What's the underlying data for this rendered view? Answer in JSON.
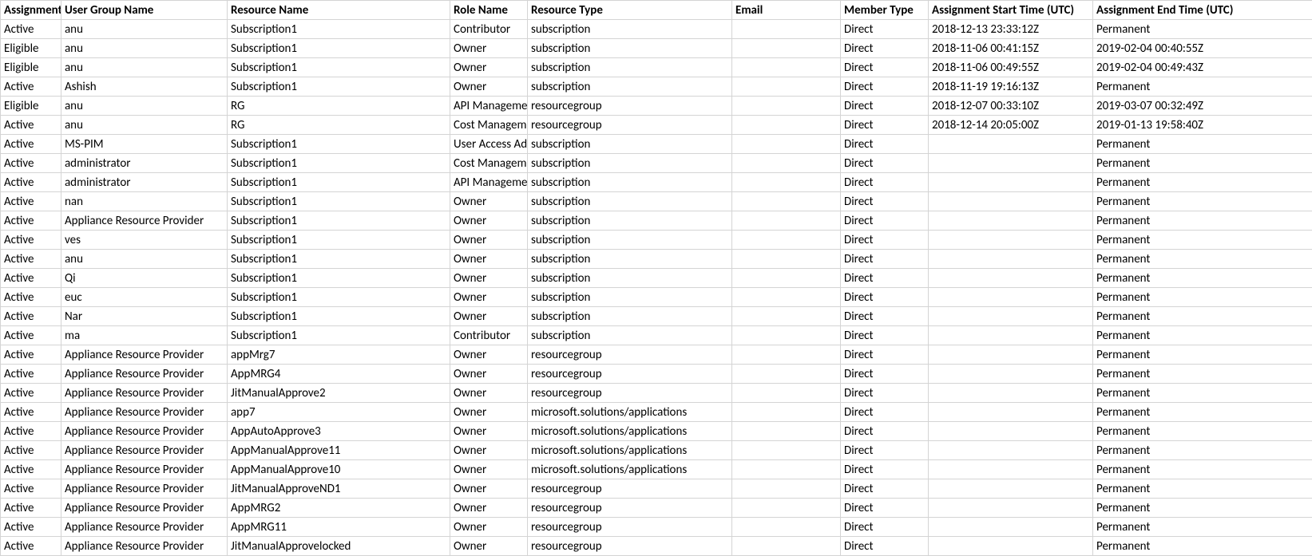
{
  "table": {
    "headers": {
      "assignment": "Assignment",
      "user_group_name": "User Group Name",
      "resource_name": "Resource Name",
      "role_name": "Role Name",
      "resource_type": "Resource Type",
      "email": "Email",
      "member_type": "Member Type",
      "assignment_start": "Assignment Start Time (UTC)",
      "assignment_end": "Assignment End Time (UTC)"
    },
    "rows": [
      {
        "assignment": "Active",
        "user_group_name": "anu",
        "resource_name": "Subscription1",
        "role_name": "Contributor",
        "resource_type": "subscription",
        "email": "",
        "member_type": "Direct",
        "start": "2018-12-13 23:33:12Z",
        "end": "Permanent"
      },
      {
        "assignment": "Eligible",
        "user_group_name": "anu",
        "resource_name": "Subscription1",
        "role_name": "Owner",
        "resource_type": "subscription",
        "email": "",
        "member_type": "Direct",
        "start": "2018-11-06 00:41:15Z",
        "end": "2019-02-04 00:40:55Z"
      },
      {
        "assignment": "Eligible",
        "user_group_name": "anu",
        "resource_name": "Subscription1",
        "role_name": "Owner",
        "resource_type": "subscription",
        "email": "",
        "member_type": "Direct",
        "start": "2018-11-06 00:49:55Z",
        "end": "2019-02-04 00:49:43Z"
      },
      {
        "assignment": "Active",
        "user_group_name": "Ashish",
        "resource_name": "Subscription1",
        "role_name": "Owner",
        "resource_type": "subscription",
        "email": "",
        "member_type": "Direct",
        "start": "2018-11-19 19:16:13Z",
        "end": "Permanent"
      },
      {
        "assignment": "Eligible",
        "user_group_name": "anu",
        "resource_name": "RG",
        "role_name": "API Management",
        "resource_type": "resourcegroup",
        "email": "",
        "member_type": "Direct",
        "start": "2018-12-07 00:33:10Z",
        "end": "2019-03-07 00:32:49Z"
      },
      {
        "assignment": "Active",
        "user_group_name": "anu",
        "resource_name": "RG",
        "role_name": "Cost Management",
        "resource_type": "resourcegroup",
        "email": "",
        "member_type": "Direct",
        "start": "2018-12-14 20:05:00Z",
        "end": "2019-01-13 19:58:40Z"
      },
      {
        "assignment": "Active",
        "user_group_name": "MS-PIM",
        "resource_name": "Subscription1",
        "role_name": "User Access Administrator",
        "resource_type": "subscription",
        "email": "",
        "member_type": "Direct",
        "start": "",
        "end": "Permanent"
      },
      {
        "assignment": "Active",
        "user_group_name": "administrator",
        "resource_name": "Subscription1",
        "role_name": "Cost Management",
        "resource_type": "subscription",
        "email": "",
        "member_type": "Direct",
        "start": "",
        "end": "Permanent"
      },
      {
        "assignment": "Active",
        "user_group_name": "administrator",
        "resource_name": "Subscription1",
        "role_name": "API Management",
        "resource_type": "subscription",
        "email": "",
        "member_type": "Direct",
        "start": "",
        "end": "Permanent"
      },
      {
        "assignment": "Active",
        "user_group_name": "nan",
        "resource_name": "Subscription1",
        "role_name": "Owner",
        "resource_type": "subscription",
        "email": "",
        "member_type": "Direct",
        "start": "",
        "end": "Permanent"
      },
      {
        "assignment": "Active",
        "user_group_name": "Appliance Resource Provider",
        "resource_name": "Subscription1",
        "role_name": "Owner",
        "resource_type": "subscription",
        "email": "",
        "member_type": "Direct",
        "start": "",
        "end": "Permanent"
      },
      {
        "assignment": "Active",
        "user_group_name": "ves",
        "resource_name": "Subscription1",
        "role_name": "Owner",
        "resource_type": "subscription",
        "email": "",
        "member_type": "Direct",
        "start": "",
        "end": "Permanent"
      },
      {
        "assignment": "Active",
        "user_group_name": "anu",
        "resource_name": "Subscription1",
        "role_name": "Owner",
        "resource_type": "subscription",
        "email": "",
        "member_type": "Direct",
        "start": "",
        "end": "Permanent"
      },
      {
        "assignment": "Active",
        "user_group_name": "Qi",
        "resource_name": "Subscription1",
        "role_name": "Owner",
        "resource_type": "subscription",
        "email": "",
        "member_type": "Direct",
        "start": "",
        "end": "Permanent"
      },
      {
        "assignment": "Active",
        "user_group_name": "euc",
        "resource_name": "Subscription1",
        "role_name": "Owner",
        "resource_type": "subscription",
        "email": "",
        "member_type": "Direct",
        "start": "",
        "end": "Permanent"
      },
      {
        "assignment": "Active",
        "user_group_name": "Nar",
        "resource_name": "Subscription1",
        "role_name": "Owner",
        "resource_type": "subscription",
        "email": "",
        "member_type": "Direct",
        "start": "",
        "end": "Permanent"
      },
      {
        "assignment": "Active",
        "user_group_name": "ma",
        "resource_name": "Subscription1",
        "role_name": "Contributor",
        "resource_type": "subscription",
        "email": "",
        "member_type": "Direct",
        "start": "",
        "end": "Permanent"
      },
      {
        "assignment": "Active",
        "user_group_name": "Appliance Resource Provider",
        "resource_name": "appMrg7",
        "role_name": "Owner",
        "resource_type": "resourcegroup",
        "email": "",
        "member_type": "Direct",
        "start": "",
        "end": "Permanent"
      },
      {
        "assignment": "Active",
        "user_group_name": "Appliance Resource Provider",
        "resource_name": "AppMRG4",
        "role_name": "Owner",
        "resource_type": "resourcegroup",
        "email": "",
        "member_type": "Direct",
        "start": "",
        "end": "Permanent"
      },
      {
        "assignment": "Active",
        "user_group_name": "Appliance Resource Provider",
        "resource_name": "JitManualApprove2",
        "role_name": "Owner",
        "resource_type": "resourcegroup",
        "email": "",
        "member_type": "Direct",
        "start": "",
        "end": "Permanent"
      },
      {
        "assignment": "Active",
        "user_group_name": "Appliance Resource Provider",
        "resource_name": "app7",
        "role_name": "Owner",
        "resource_type": "microsoft.solutions/applications",
        "email": "",
        "member_type": "Direct",
        "start": "",
        "end": "Permanent"
      },
      {
        "assignment": "Active",
        "user_group_name": "Appliance Resource Provider",
        "resource_name": "AppAutoApprove3",
        "role_name": "Owner",
        "resource_type": "microsoft.solutions/applications",
        "email": "",
        "member_type": "Direct",
        "start": "",
        "end": "Permanent"
      },
      {
        "assignment": "Active",
        "user_group_name": "Appliance Resource Provider",
        "resource_name": "AppManualApprove11",
        "role_name": "Owner",
        "resource_type": "microsoft.solutions/applications",
        "email": "",
        "member_type": "Direct",
        "start": "",
        "end": "Permanent"
      },
      {
        "assignment": "Active",
        "user_group_name": "Appliance Resource Provider",
        "resource_name": "AppManualApprove10",
        "role_name": "Owner",
        "resource_type": "microsoft.solutions/applications",
        "email": "",
        "member_type": "Direct",
        "start": "",
        "end": "Permanent"
      },
      {
        "assignment": "Active",
        "user_group_name": "Appliance Resource Provider",
        "resource_name": "JitManualApproveND1",
        "role_name": "Owner",
        "resource_type": "resourcegroup",
        "email": "",
        "member_type": "Direct",
        "start": "",
        "end": "Permanent"
      },
      {
        "assignment": "Active",
        "user_group_name": "Appliance Resource Provider",
        "resource_name": "AppMRG2",
        "role_name": "Owner",
        "resource_type": "resourcegroup",
        "email": "",
        "member_type": "Direct",
        "start": "",
        "end": "Permanent"
      },
      {
        "assignment": "Active",
        "user_group_name": "Appliance Resource Provider",
        "resource_name": "AppMRG11",
        "role_name": "Owner",
        "resource_type": "resourcegroup",
        "email": "",
        "member_type": "Direct",
        "start": "",
        "end": "Permanent"
      },
      {
        "assignment": "Active",
        "user_group_name": "Appliance Resource Provider",
        "resource_name": "JitManualApprovelocked",
        "role_name": "Owner",
        "resource_type": "resourcegroup",
        "email": "",
        "member_type": "Direct",
        "start": "",
        "end": "Permanent"
      }
    ]
  }
}
